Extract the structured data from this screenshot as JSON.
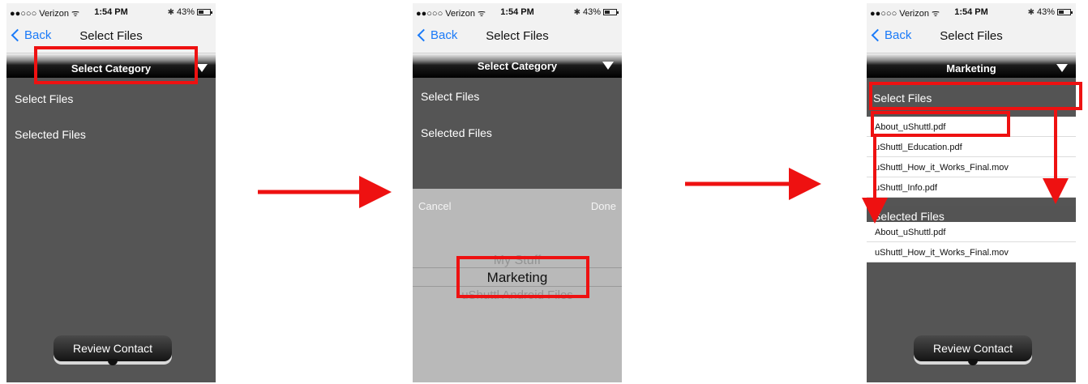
{
  "status": {
    "carrier": "●●○○○ Verizon ᯤ",
    "time": "1:54 PM",
    "battery": "43%"
  },
  "nav": {
    "back": "Back",
    "title": "Select Files"
  },
  "category": {
    "default_label": "Select Category",
    "selected_label": "Marketing"
  },
  "menu": {
    "select_files": "Select Files",
    "selected_files": "Selected Files"
  },
  "review_button": "Review Contact",
  "picker": {
    "cancel": "Cancel",
    "done": "Done",
    "options": [
      "My Stuff",
      "Marketing",
      "uShuttl Android Files"
    ]
  },
  "files": [
    "About_uShuttl.pdf",
    "uShuttl_Education.pdf",
    "uShuttl_How_it_Works_Final.mov",
    "uShuttl_Info.pdf"
  ],
  "selected_files": [
    "About_uShuttl.pdf",
    "uShuttl_How_it_Works_Final.mov"
  ],
  "colors": {
    "highlight": "#ee1111",
    "ios_blue": "#1a7af8",
    "panel": "#555555"
  }
}
